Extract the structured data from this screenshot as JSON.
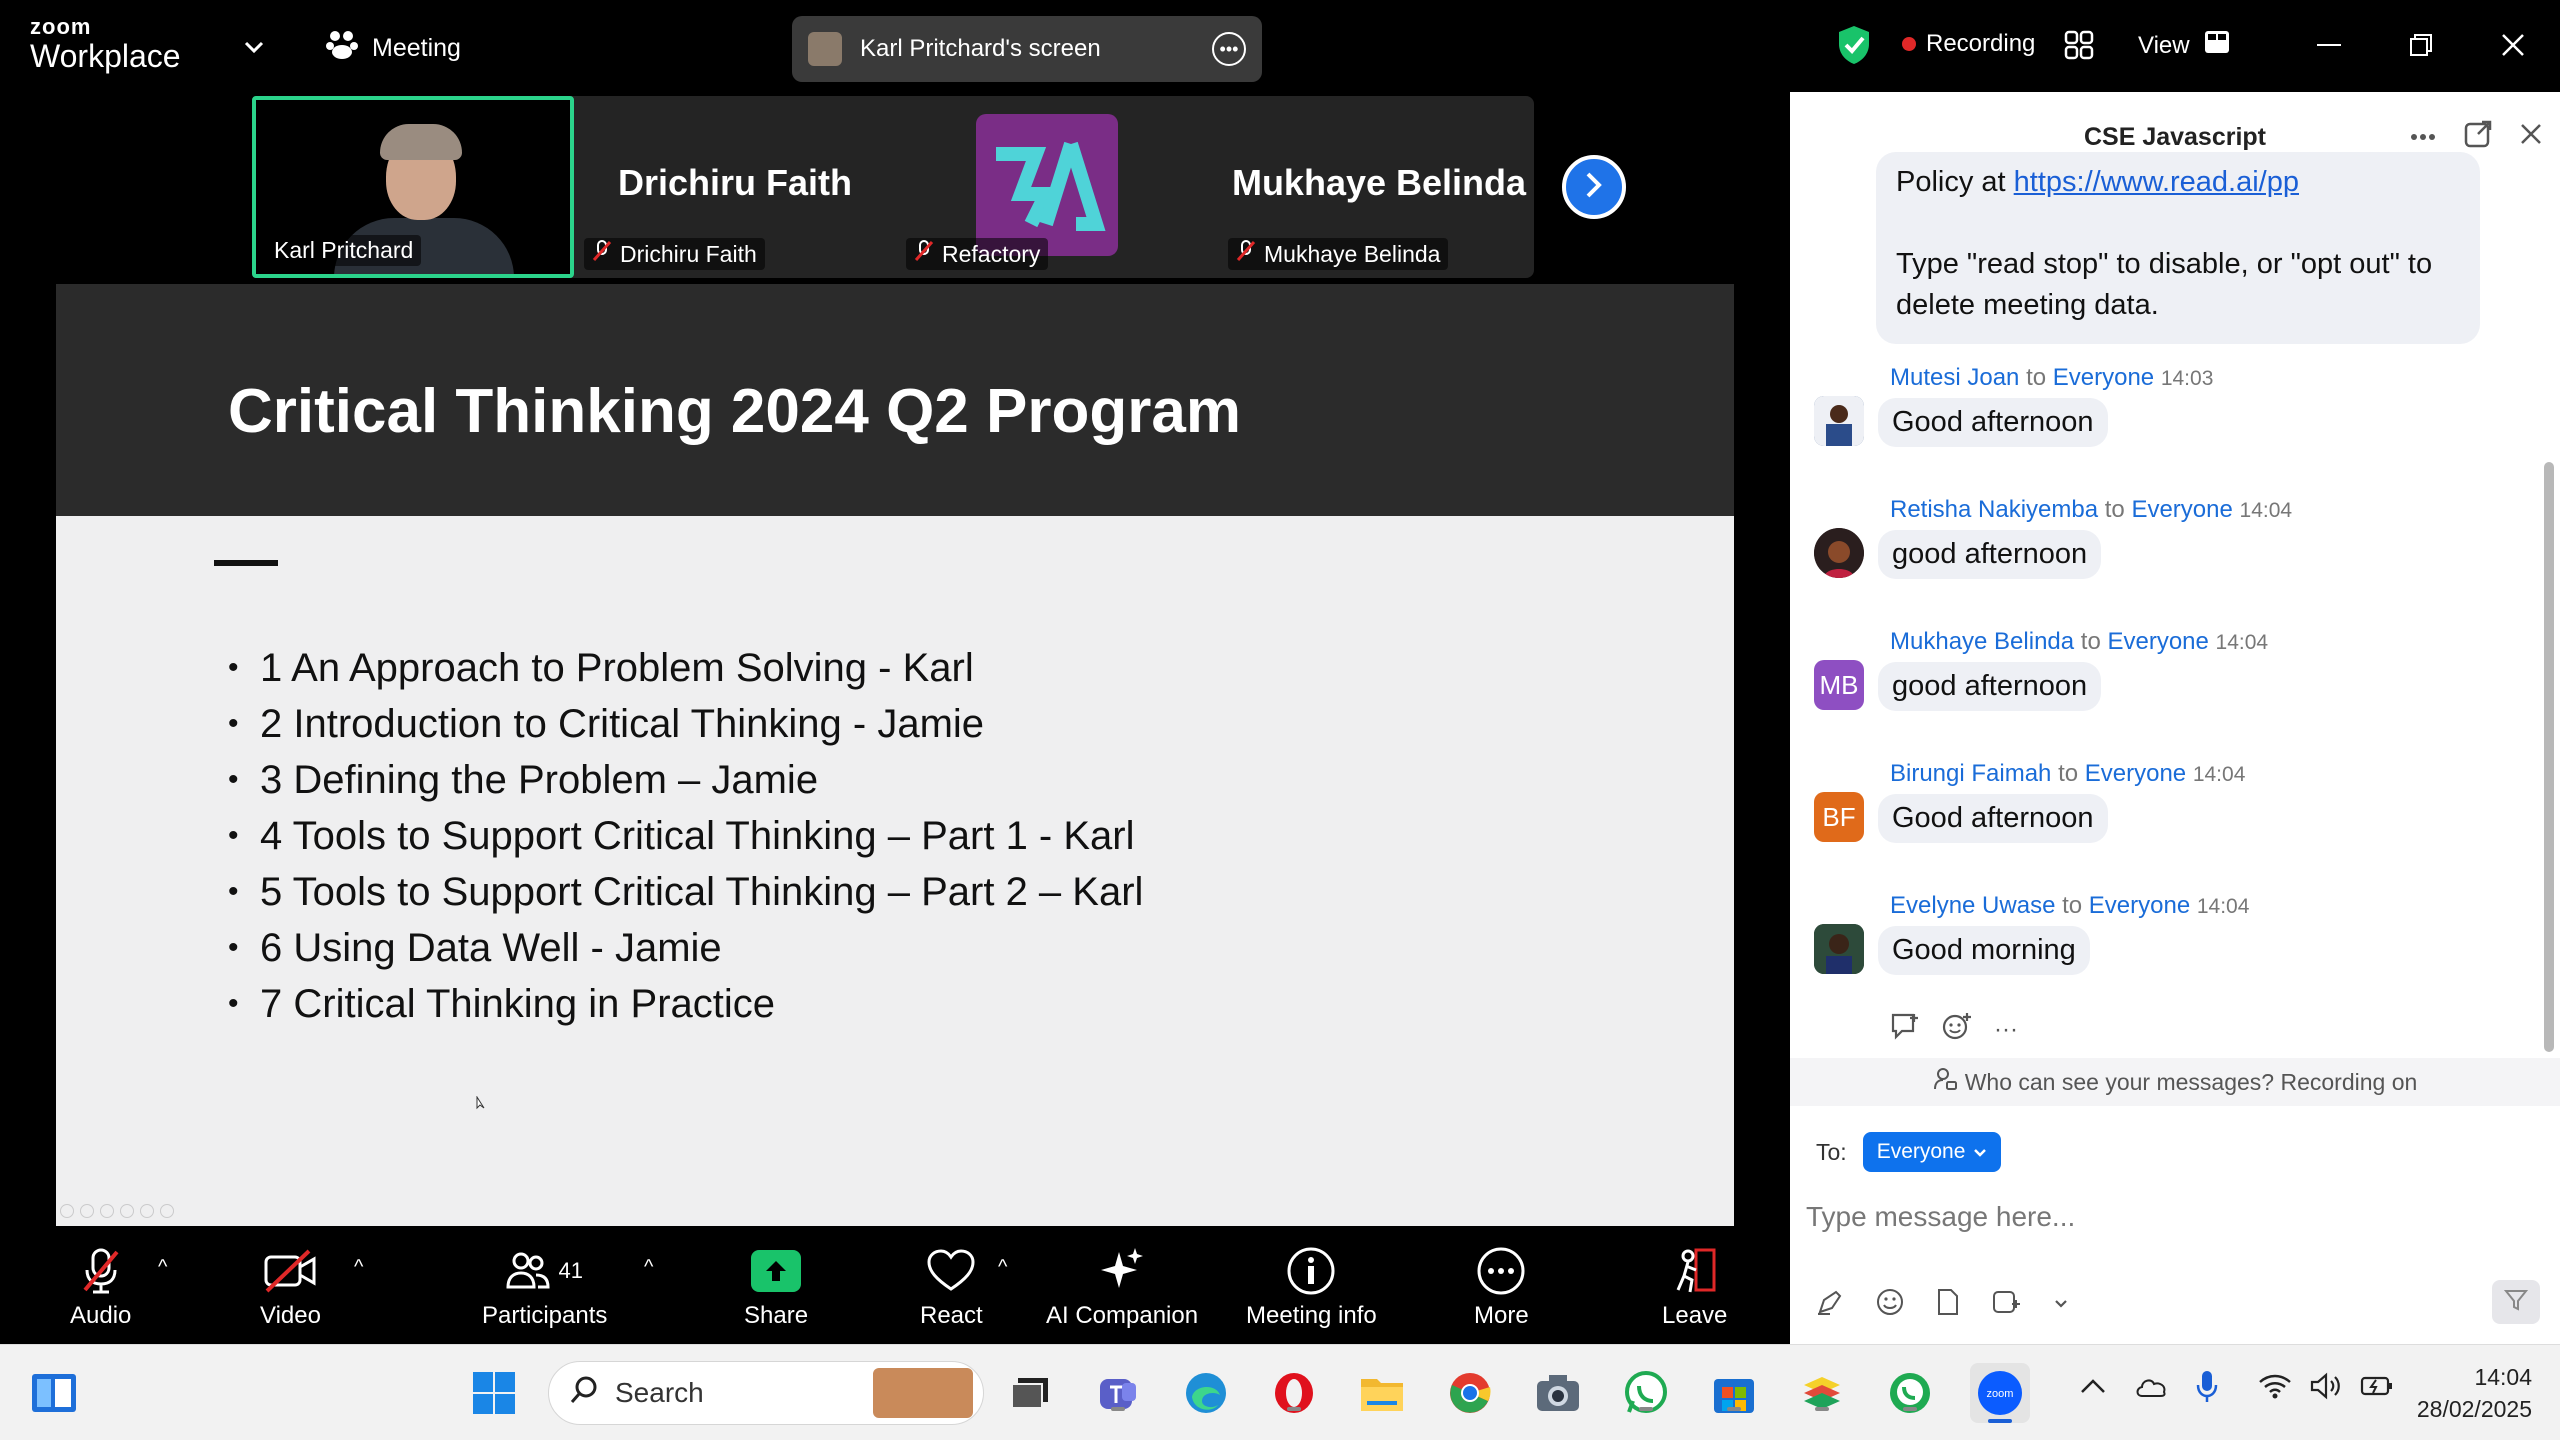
{
  "app": {
    "brand_top": "zoom",
    "brand_name": "Workplace",
    "meeting_label": "Meeting",
    "screen_share_label": "Karl Pritchard's screen",
    "recording_label": "Recording",
    "view_label": "View"
  },
  "participants_strip": [
    {
      "name": "Karl Pritchard",
      "big_name": "",
      "muted": false
    },
    {
      "name": "Drichiru Faith",
      "big_name": "Drichiru Faith",
      "muted": true
    },
    {
      "name": "Refactory",
      "big_name": "",
      "muted": true
    },
    {
      "name": "Mukhaye Belinda",
      "big_name": "Mukhaye Belinda",
      "muted": true
    }
  ],
  "slide": {
    "title": "Critical Thinking 2024 Q2 Program",
    "items": [
      "1 An Approach to Problem Solving - Karl",
      "2 Introduction to Critical Thinking - Jamie",
      "3 Defining the Problem – Jamie",
      "4 Tools to Support Critical Thinking – Part 1 - Karl",
      "5 Tools to Support Critical Thinking – Part 2 – Karl",
      "6 Using Data Well - Jamie",
      "7 Critical Thinking in Practice"
    ]
  },
  "toolbar": {
    "audio": "Audio",
    "video": "Video",
    "participants": "Participants",
    "participants_count": "41",
    "share": "Share",
    "react": "React",
    "ai_companion": "AI Companion",
    "meeting_info": "Meeting info",
    "more": "More",
    "leave": "Leave"
  },
  "chat": {
    "title": "CSE Javascript",
    "system_top_text": "Policy at ",
    "system_link": "https://www.read.ai/pp",
    "system_text": "Type \"read stop\" to disable, or \"opt out\" to delete meeting data.",
    "to_word": "to",
    "messages": [
      {
        "sender": "Mutesi Joan",
        "recipient": "Everyone",
        "time": "14:03",
        "text": "Good afternoon",
        "initials": "",
        "avatar_color": "#3a5a8c"
      },
      {
        "sender": "Retisha Nakiyemba",
        "recipient": "Everyone",
        "time": "14:04",
        "text": "good afternoon",
        "initials": "",
        "avatar_color": "#2a1e1e"
      },
      {
        "sender": "Mukhaye Belinda",
        "recipient": "Everyone",
        "time": "14:04",
        "text": "good afternoon",
        "initials": "MB",
        "avatar_color": "#8e4fc2"
      },
      {
        "sender": "Birungi Faimah",
        "recipient": "Everyone",
        "time": "14:04",
        "text": "Good afternoon",
        "initials": "BF",
        "avatar_color": "#e06a1a"
      },
      {
        "sender": "Evelyne Uwase",
        "recipient": "Everyone",
        "time": "14:04",
        "text": "Good morning",
        "initials": "",
        "avatar_color": "#2d4a3a"
      }
    ],
    "privacy_text": "Who can see your messages? Recording on",
    "to_label": "To:",
    "to_value": "Everyone",
    "input_placeholder": "Type message here..."
  },
  "taskbar": {
    "search_placeholder": "Search",
    "time": "14:04",
    "date": "28/02/2025"
  }
}
